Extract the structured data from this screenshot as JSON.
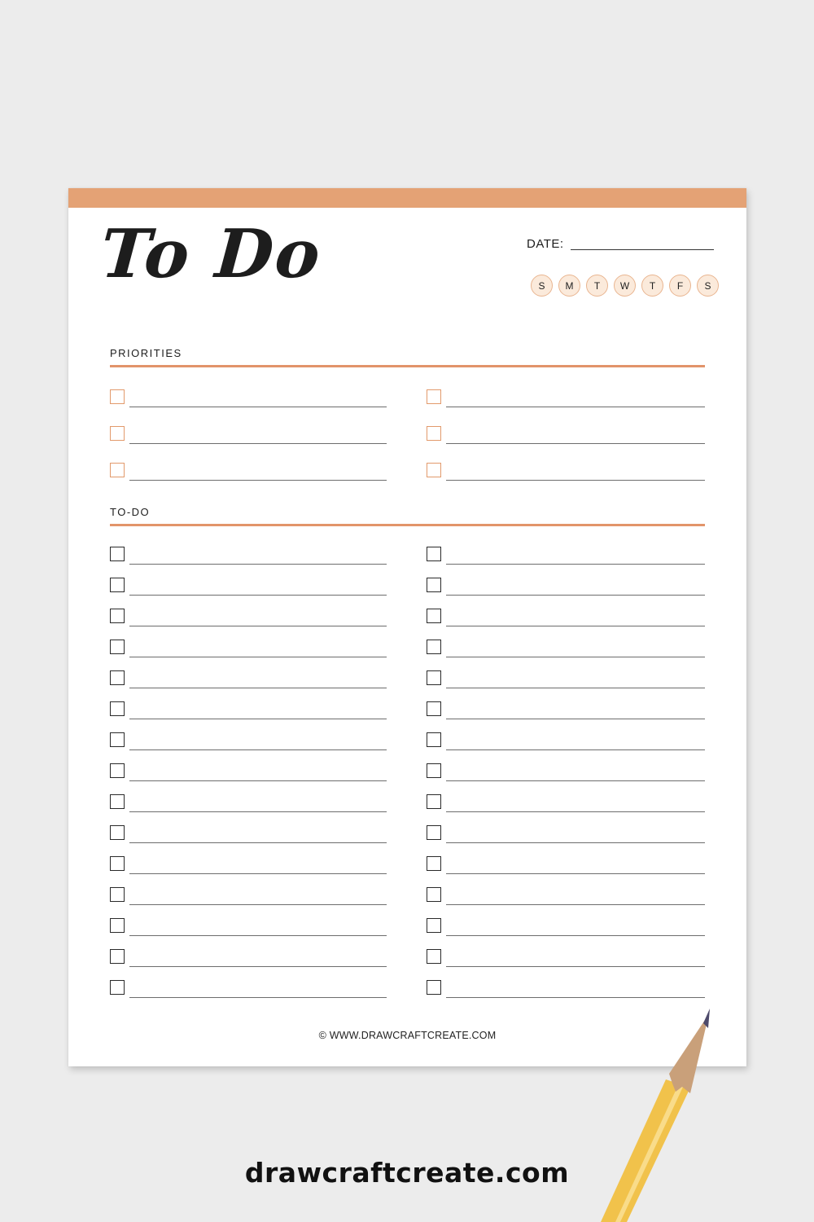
{
  "colors": {
    "accent": "#e4a275",
    "rule": "#e2946a",
    "priority_checkbox": "#e29a6c",
    "day_fill": "#fbeadb",
    "day_border": "#e9b590",
    "background": "#ececec"
  },
  "page": {
    "title": "To Do",
    "date_label": "DATE:",
    "days": [
      "S",
      "M",
      "T",
      "W",
      "T",
      "F",
      "S"
    ],
    "sections": {
      "priorities": {
        "title": "PRIORITIES",
        "columns": 2,
        "rows_per_column": 3
      },
      "todo": {
        "title": "TO-DO",
        "columns": 2,
        "rows_per_column": 15
      }
    },
    "copyright": "© WWW.DRAWCRAFTCREATE.COM"
  },
  "footer": {
    "site": "drawcraftcreate.com"
  },
  "decor": {
    "pencil": "pencil-icon"
  }
}
